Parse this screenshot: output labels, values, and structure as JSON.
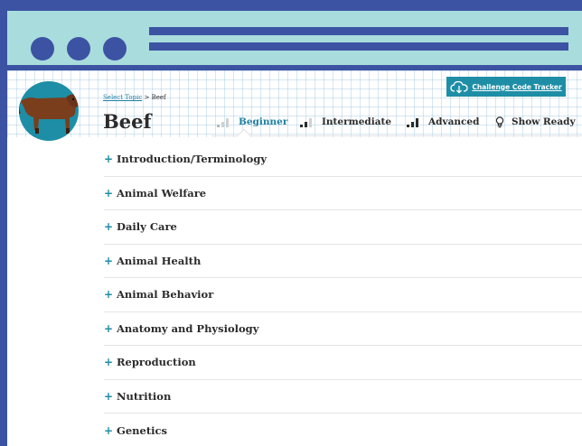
{
  "colors": {
    "frame": "#3c53a3",
    "titlebar": "#a9dcdc",
    "accent": "#1e8ea6",
    "text": "#2b2b2b"
  },
  "breadcrumb": {
    "link": "Select Topic",
    "separator": ">",
    "current": "Beef"
  },
  "tracker": {
    "label": "Challenge Code Tracker",
    "icon": "cloud-download-icon"
  },
  "page": {
    "title": "Beef",
    "avatar_icon": "cow-icon"
  },
  "tabs": [
    {
      "label": "Beginner",
      "icon": "signal-bars-1-icon",
      "active": true
    },
    {
      "label": "Intermediate",
      "icon": "signal-bars-2-icon",
      "active": false
    },
    {
      "label": "Advanced",
      "icon": "signal-bars-3-icon",
      "active": false
    },
    {
      "label": "Show Ready",
      "icon": "lightbulb-icon",
      "active": false
    }
  ],
  "topics": [
    {
      "label": "Introduction/Terminology"
    },
    {
      "label": "Animal Welfare"
    },
    {
      "label": "Daily Care"
    },
    {
      "label": "Animal Health"
    },
    {
      "label": "Animal Behavior"
    },
    {
      "label": "Anatomy and Physiology"
    },
    {
      "label": "Reproduction"
    },
    {
      "label": "Nutrition"
    },
    {
      "label": "Genetics"
    }
  ],
  "topic_prefix": "+"
}
